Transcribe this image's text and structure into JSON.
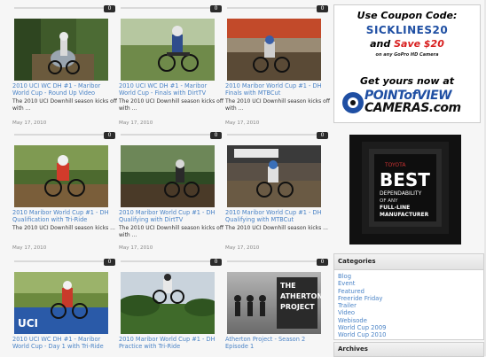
{
  "videos": [
    {
      "title": "2010 UCI WC DH #1 - Maribor World Cup - Round Up Video",
      "desc": "The 2010 UCI Downhill season kicks off with ...",
      "date": "May 17, 2010",
      "comments": "0",
      "scene": "forest-riders"
    },
    {
      "title": "2010 UCI WC DH #1 - Maribor World Cup - Finals with DirtTV",
      "desc": "The 2010 UCI Downhill season kicks off with ...",
      "date": "May 17, 2010",
      "comments": "0",
      "scene": "green-rider"
    },
    {
      "title": "2010 Maribor World Cup #1 - DH Finals with MTBCut",
      "desc": "The 2010 UCI Downhill season kicks off with ...",
      "date": "May 17, 2010",
      "comments": "0",
      "scene": "crowd-rider"
    },
    {
      "title": "2010 Maribor World Cup #1 - DH Qualification with Tri-Ride",
      "desc": "The 2010 UCI Downhill season kicks ...",
      "date": "May 17, 2010",
      "comments": "0",
      "scene": "mud-rider"
    },
    {
      "title": "2010 Maribor World Cup #1 - DH Qualifying with DirtTV",
      "desc": "The 2010 UCI Downhill season kicks off with ...",
      "date": "May 17, 2010",
      "comments": "0",
      "scene": "trees-rider"
    },
    {
      "title": "2010 Maribor World Cup #1 - DH Qualifying with MTBCut",
      "desc": "The 2010 UCI Downhill season kicks ...",
      "date": "May 17, 2010",
      "comments": "0",
      "scene": "banner-rider"
    },
    {
      "title": "2010 UCI WC DH #1 - Maribor World Cup - Day 1 with Tri-Ride",
      "desc": "",
      "date": "",
      "comments": "0",
      "scene": "uci-rider"
    },
    {
      "title": "2010 Maribor World Cup #1 - DH Practice with Tri-Ride",
      "desc": "",
      "date": "",
      "comments": "0",
      "scene": "jump-rider"
    },
    {
      "title": "Atherton Project - Season 2 Episode 1",
      "desc": "",
      "date": "",
      "comments": "0",
      "scene": "atherton"
    }
  ],
  "thumb_text": {
    "atherton_line1": "THE",
    "atherton_line2": "ATHERTON",
    "atherton_line3": "PROJECT",
    "uci": "UCI"
  },
  "ad_gopro": {
    "line1": "Use Coupon Code:",
    "code": "SICKLINES20",
    "line3_a": "and ",
    "line3_b": "Save $20",
    "line4": "on any GoPro HD Camera",
    "line5": "Get yours now at",
    "brand1": "POINTofVIEW",
    "brand2": "CAMERAS.com"
  },
  "ad_toyota": {
    "brand": "TOYOTA",
    "big": "BEST",
    "sub1": "DEPENDABILITY",
    "sub2": "OF ANY",
    "sub3": "FULL-LINE",
    "sub4": "MANUFACTURER"
  },
  "categories": {
    "heading": "Categories",
    "items": [
      "Blog",
      "Event",
      "Featured",
      "Freeride Friday",
      "Trailer",
      "Video",
      "Webisode",
      "World Cup 2009",
      "World Cup 2010"
    ]
  },
  "archives": {
    "heading": "Archives"
  },
  "colors": {
    "link": "#4a83c6",
    "badge": "#2b2b2b",
    "accent_red": "#d82020",
    "accent_blue": "#1f4fa3"
  }
}
